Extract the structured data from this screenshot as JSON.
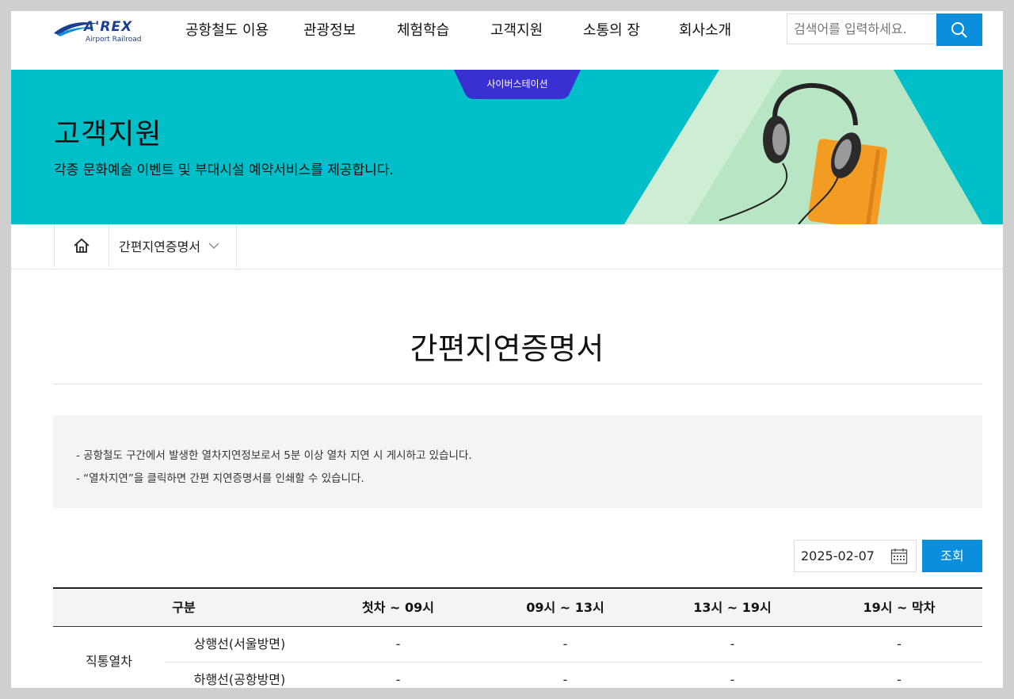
{
  "header": {
    "logo_brand": "A'REX",
    "logo_sub": "Airport Railroad",
    "nav": [
      "공항철도 이용",
      "관광정보",
      "체험학습",
      "고객지원",
      "소통의 장",
      "회사소개"
    ],
    "search_placeholder": "검색어를 입력하세요.",
    "search_icon": "search-icon"
  },
  "banner": {
    "badge": "사이버스테이션",
    "title": "고객지원",
    "subtitle": "각종 문화예술 이벤트 및 부대시설 예약서비스를 제공합니다.",
    "colors": {
      "teal": "#00bfc8",
      "badge": "#3a2fd1",
      "mint": "#b8e6c4"
    }
  },
  "breadcrumb": {
    "home_icon": "home-icon",
    "current": "간편지연증명서"
  },
  "main": {
    "title": "간편지연증명서",
    "notice": [
      "- 공항철도 구간에서 발생한 열차지연정보로서 5분 이상 열차 지연 시 게시하고 있습니다.",
      "- “열차지연”을 클릭하면 간편 지연증명서를 인쇄할 수 있습니다."
    ],
    "date_value": "2025-02-07",
    "query_label": "조회"
  },
  "table": {
    "headers": [
      "구분",
      "첫차 ~ 09시",
      "09시 ~ 13시",
      "13시 ~ 19시",
      "19시 ~ 막차"
    ],
    "group": "직통열차",
    "rows": [
      {
        "label": "상행선(서울방면)",
        "cells": [
          "-",
          "-",
          "-",
          "-"
        ]
      },
      {
        "label": "하행선(공항방면)",
        "cells": [
          "-",
          "-",
          "-",
          "-"
        ]
      }
    ]
  },
  "accent_color": "#0b8fdd"
}
